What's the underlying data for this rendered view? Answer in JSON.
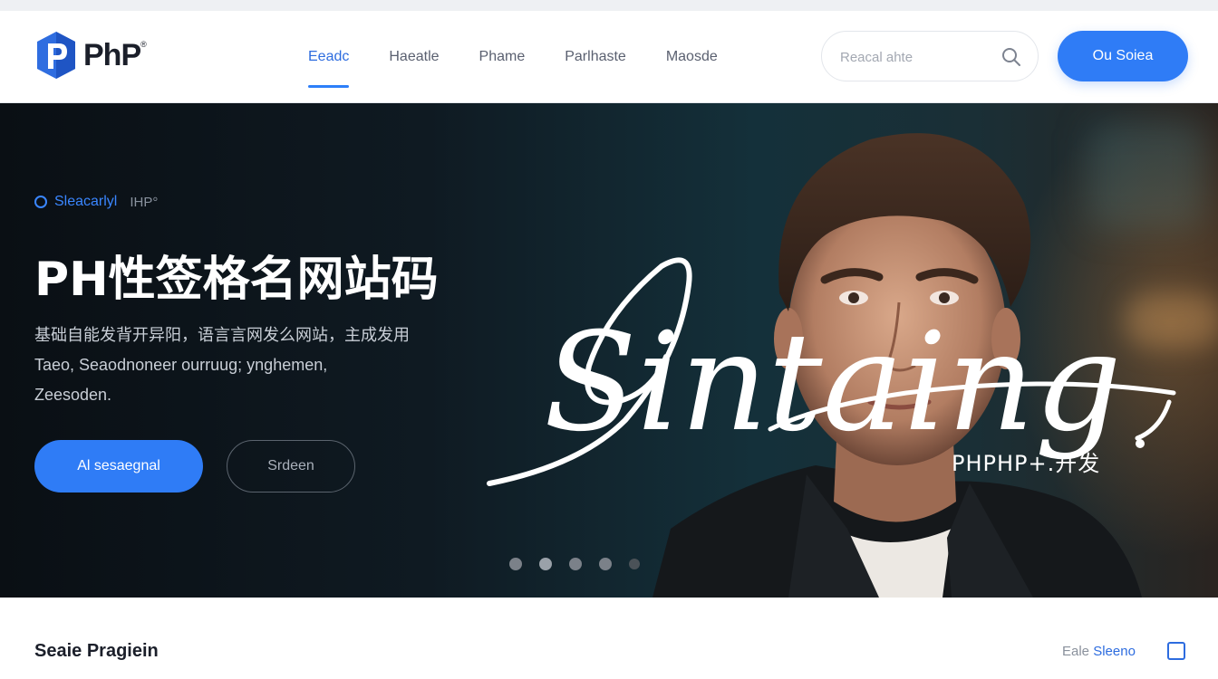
{
  "header": {
    "logo_text": "PhP",
    "logo_reg": "®",
    "nav": [
      {
        "label": "Eeadc",
        "active": true
      },
      {
        "label": "Haeatle"
      },
      {
        "label": "Phame"
      },
      {
        "label": "Parlhaste"
      },
      {
        "label": "Maosde"
      }
    ],
    "search_placeholder": "Reacal ahte",
    "cta_label": "Ou Soiea"
  },
  "hero": {
    "tag_main": "Sleacarlyl",
    "tag_sub": "IHP°",
    "title": "PH性签格名网站码",
    "desc_line1": "基础自能发背开异阳，语言言网发么网站，主成发用",
    "desc_line2": "Taeo, Seaodnoneer ourruug; ynghemen,",
    "desc_line3": "Zeesoden.",
    "primary_button": "Al sesaegnal",
    "secondary_button": "Srdeen",
    "signature_text": "Sintaing",
    "signature_caption": "PHPHP+.开发",
    "carousel_active_index": 1
  },
  "section": {
    "title": "Seaie Pragiein",
    "link_prefix": "Eale",
    "link_label": "Sleeno"
  },
  "colors": {
    "accent": "#2f7cf6",
    "hero_dark": "#0a0f14"
  }
}
